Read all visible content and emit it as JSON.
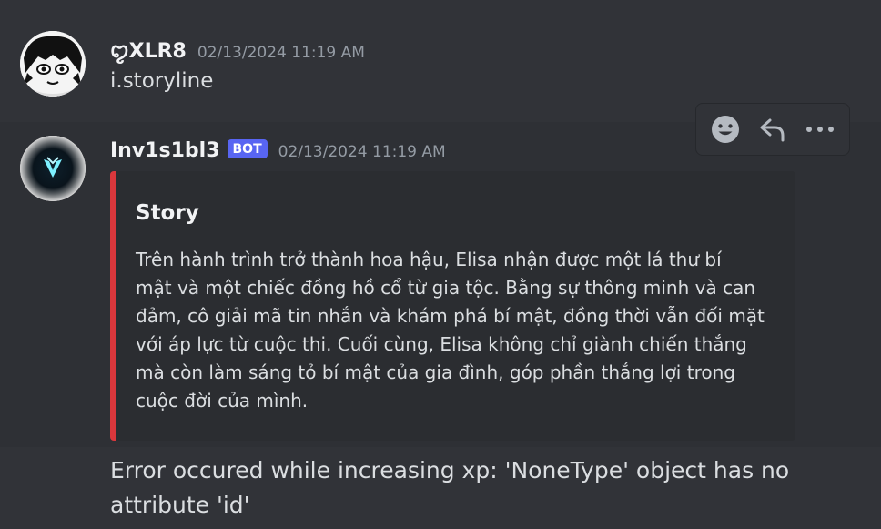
{
  "messages": [
    {
      "username": "ꨄXLR8",
      "timestamp": "02/13/2024 11:19 AM",
      "content": "i.storyline"
    },
    {
      "username": "Inv1s1bl3",
      "bot_tag": "BOT",
      "timestamp": "02/13/2024 11:19 AM",
      "embed": {
        "title": "Story",
        "accent_color": "#da373c",
        "description_lines": [
          "Trên hành trình trở thành hoa hậu, Elisa nhận được một lá thư bí",
          "mật và một chiếc đồng hồ cổ từ gia tộc. Bằng sự thông minh và can",
          "đảm, cô giải mã tin nhắn và khám phá bí mật, đồng thời vẫn đối mặt",
          "với áp lực từ cuộc thi. Cuối cùng, Elisa không chỉ giành chiến thắng",
          "mà còn làm sáng tỏ bí mật của gia đình, góp phần thắng lợi trong",
          "cuộc đời của mình."
        ]
      },
      "followup_lines": [
        "Error occured while increasing xp: 'NoneType' object has no",
        "attribute 'id'"
      ]
    }
  ],
  "toolbar": {
    "icons": [
      "add-reaction-icon",
      "reply-icon",
      "more-options-icon"
    ]
  },
  "colors": {
    "background": "#313338",
    "bot_tag": "#5865f2",
    "timestamp": "#949ba4"
  }
}
